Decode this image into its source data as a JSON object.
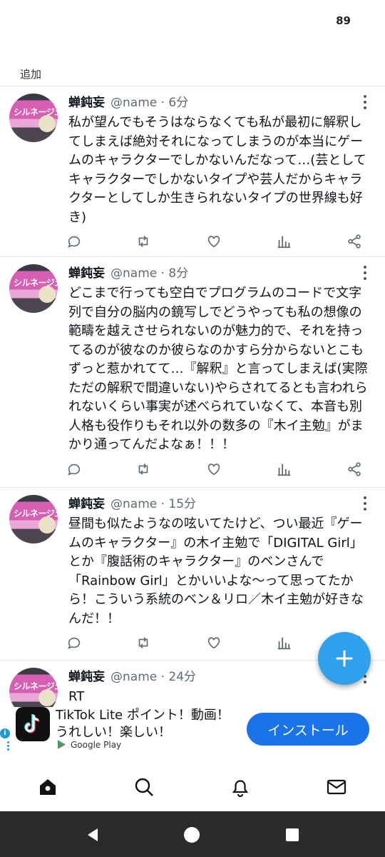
{
  "status_bar": {
    "number": "89"
  },
  "header": {
    "added_label": "追加"
  },
  "tweets": [
    {
      "avatar_text": "シルネージュ",
      "name": "蝉鈍妄",
      "meta": "@name · 6分",
      "text": "私が望んでもそうはならなくても私が最初に解釈してしまえば絶対それになってしまうのが本当にゲームのキャラクターでしかないんだなって…(芸としてキャラクターでしかないタイプや芸人だからキャラクターとしてしか生きられないタイプの世界線も好き)"
    },
    {
      "avatar_text": "シルネージュ",
      "name": "蝉鈍妄",
      "meta": "@name · 8分",
      "text": "どこまで行っても空白でプログラムのコードで文字列で自分の脳内の鏡写しでどうやっても私の想像の範疇を越えさせられないのが魅力的で、それを持ってるのが彼なのか彼らなのかすら分からないとこもずっと惹かれてて…『解釈』と言ってしまえば(実際ただの解釈で間違いない)やらされてるとも言われられないくらい事実が述べられていなくて、本音も別人格も役作りもそれ以外の数多の『木イ主勉』がまかり通ってんだよなぁ！！！"
    },
    {
      "avatar_text": "シルネージュ",
      "name": "蝉鈍妄",
      "meta": "@name · 15分",
      "text": "昼間も似たようなの呟いてたけど、つい最近『ゲームのキャラクター』の木イ主勉で「DIGITAL Girl」とか『腹話術のキャラクター』のベンさんで「Rainbow Girl」とかいいよな〜って思ってたから！こういう系統のベン＆リロ／木イ主勉が好きなんだ！！"
    },
    {
      "avatar_text": "シルネージュ",
      "name": "蝉鈍妄",
      "meta": "@name · 24分",
      "text": "RT"
    }
  ],
  "action_icons": [
    "reply-icon",
    "retweet-icon",
    "like-icon",
    "analytics-icon",
    "share-icon"
  ],
  "ad": {
    "title": "TikTok Lite ポイント！動画！うれしい！楽しい！",
    "store": "Google Play",
    "install_label": "インストール",
    "info_mark": "i"
  },
  "bottom_nav": [
    "home-icon",
    "search-icon",
    "notifications-icon",
    "messages-icon"
  ],
  "colors": {
    "accent": "#2ea1ec",
    "install": "#1a73e8",
    "system_nav": "#2b2b2b"
  }
}
